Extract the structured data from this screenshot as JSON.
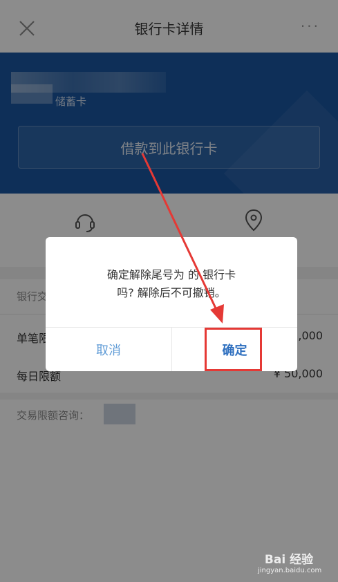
{
  "header": {
    "title": "银行卡详情",
    "more": "···"
  },
  "card": {
    "type_label": "储蓄卡",
    "loan_button": "借款到此银行卡"
  },
  "limits": {
    "header": "银行交",
    "single_label": "单笔限",
    "single_value": "5,000",
    "daily_label": "每日限额",
    "daily_value": "¥ 50,000",
    "consult_label": "交易限额咨询："
  },
  "dialog": {
    "message_line1": "确定解除尾号为 的 银行卡",
    "message_line2": "吗? 解除后不可撤销。",
    "cancel_label": "取消",
    "confirm_label": "确定"
  },
  "watermark": {
    "main": "Bai 经验",
    "sub": "jingyan.baidu.com"
  },
  "colors": {
    "card_blue": "#1b57a1",
    "annotation_red": "#e53935",
    "link_blue": "#5f9bd6"
  }
}
